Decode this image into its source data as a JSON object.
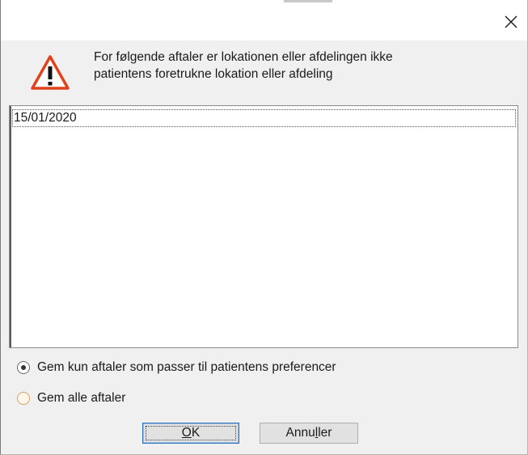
{
  "window": {
    "close_icon": "close-icon"
  },
  "message": {
    "icon": "warning-icon",
    "line1": "For følgende aftaler er lokationen eller afdelingen ikke",
    "line2": "patientens foretrukne lokation eller afdeling"
  },
  "appointments": {
    "items": [
      {
        "date": "15/01/2020",
        "selected": true
      }
    ]
  },
  "options": {
    "save_matching_label": "Gem kun aftaler som passer til patientens preferencer",
    "save_matching_selected": true,
    "save_all_label": "Gem alle aftaler",
    "save_all_selected": false
  },
  "buttons": {
    "ok_prefix": "",
    "ok_mnemonic": "O",
    "ok_suffix": "K",
    "cancel_prefix": "Annu",
    "cancel_mnemonic": "l",
    "cancel_suffix": "ler"
  },
  "colors": {
    "warning_red": "#e0421b",
    "dialog_bg": "#f0f0f0",
    "default_button_border": "#2f6fb8"
  }
}
